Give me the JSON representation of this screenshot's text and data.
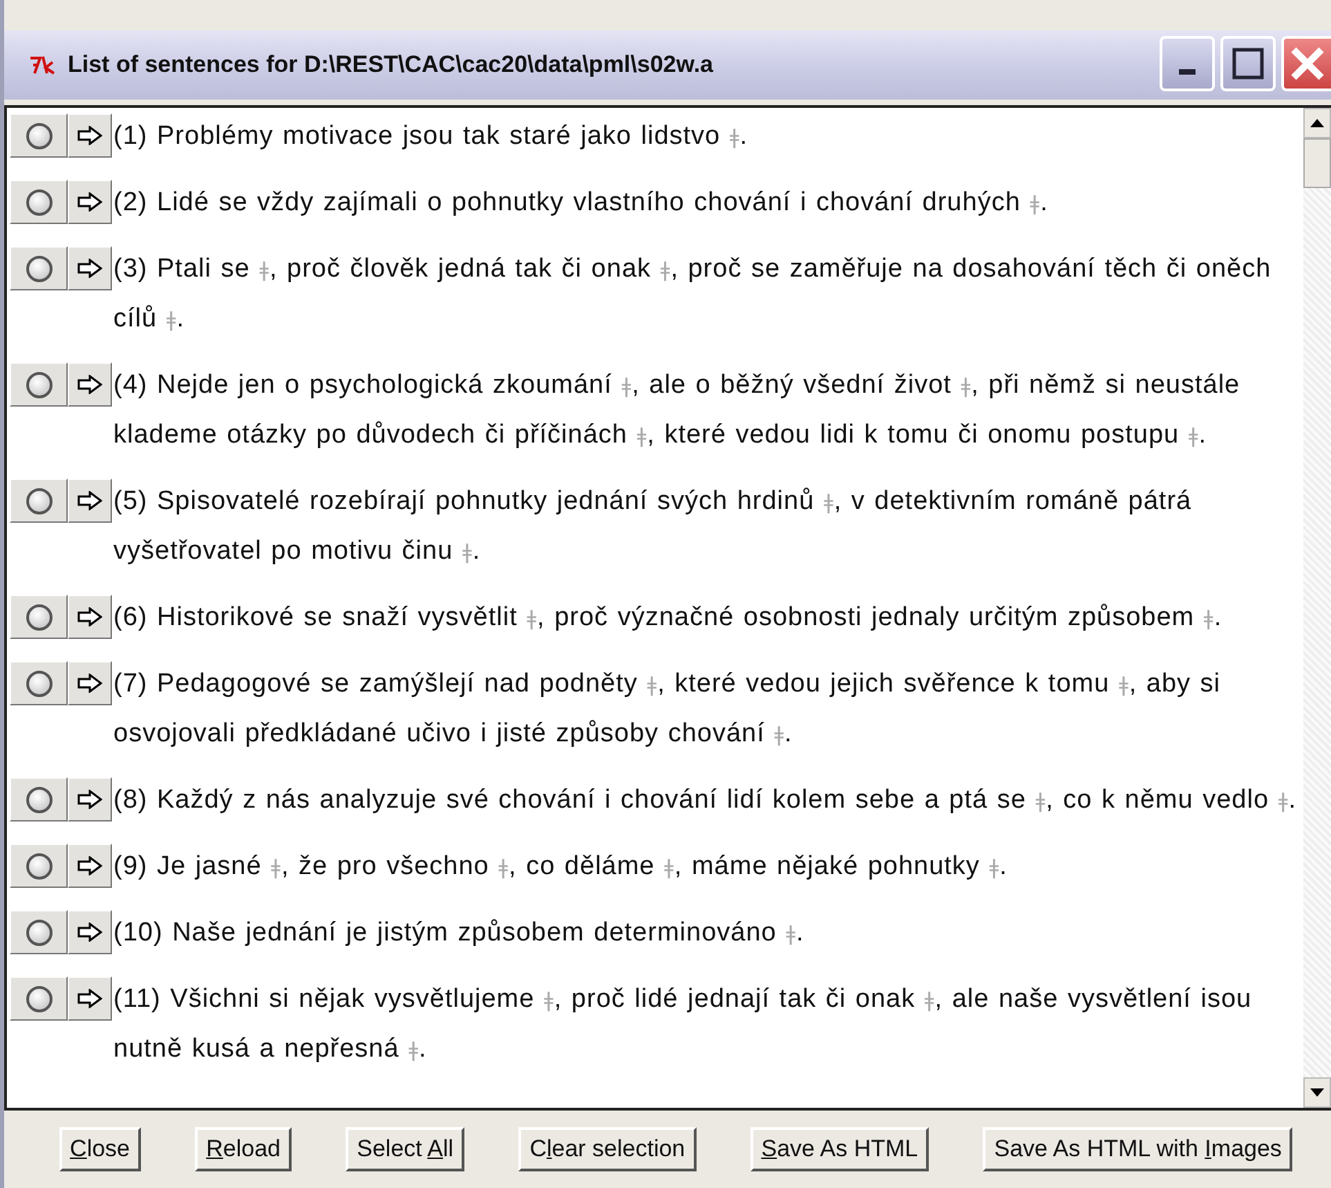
{
  "window": {
    "title": "List of sentences for D:\\REST\\CAC\\cac20\\data\\pml\\s02w.a"
  },
  "sentences": [
    {
      "selected": false,
      "segments": [
        {
          "kind": "text",
          "text": "(1) Problémy motivace jsou tak staré jako lidstvo "
        },
        {
          "kind": "token",
          "text": "ǂ"
        },
        {
          "kind": "text",
          "text": "."
        }
      ]
    },
    {
      "selected": false,
      "segments": [
        {
          "kind": "text",
          "text": "(2) Lidé se vždy zajímali o pohnutky vlastního chování i chování druhých "
        },
        {
          "kind": "token",
          "text": "ǂ"
        },
        {
          "kind": "text",
          "text": "."
        }
      ]
    },
    {
      "selected": false,
      "segments": [
        {
          "kind": "text",
          "text": "(3) Ptali se "
        },
        {
          "kind": "token",
          "text": "ǂ"
        },
        {
          "kind": "text",
          "text": ", proč člověk jedná tak či onak "
        },
        {
          "kind": "token",
          "text": "ǂ"
        },
        {
          "kind": "text",
          "text": ", proč se zaměřuje na dosahování těch či oněch cílů "
        },
        {
          "kind": "token",
          "text": "ǂ"
        },
        {
          "kind": "text",
          "text": "."
        }
      ]
    },
    {
      "selected": false,
      "segments": [
        {
          "kind": "text",
          "text": "(4) Nejde jen o psychologická zkoumání "
        },
        {
          "kind": "token",
          "text": "ǂ"
        },
        {
          "kind": "text",
          "text": ", ale o běžný všední život "
        },
        {
          "kind": "token",
          "text": "ǂ"
        },
        {
          "kind": "text",
          "text": ", při němž si neustále klademe otázky po důvodech či příčinách "
        },
        {
          "kind": "token",
          "text": "ǂ"
        },
        {
          "kind": "text",
          "text": ", které vedou lidi k tomu či onomu postupu "
        },
        {
          "kind": "token",
          "text": "ǂ"
        },
        {
          "kind": "text",
          "text": "."
        }
      ]
    },
    {
      "selected": false,
      "segments": [
        {
          "kind": "text",
          "text": "(5) Spisovatelé rozebírají pohnutky jednání svých hrdinů "
        },
        {
          "kind": "token",
          "text": "ǂ"
        },
        {
          "kind": "text",
          "text": ", v detektivním románě pátrá vyšetřovatel po motivu činu "
        },
        {
          "kind": "token",
          "text": "ǂ"
        },
        {
          "kind": "text",
          "text": "."
        }
      ]
    },
    {
      "selected": false,
      "segments": [
        {
          "kind": "text",
          "text": "(6) Historikové se snaží vysvětlit "
        },
        {
          "kind": "token",
          "text": "ǂ"
        },
        {
          "kind": "text",
          "text": ", proč význačné osobnosti jednaly určitým způsobem "
        },
        {
          "kind": "token",
          "text": "ǂ"
        },
        {
          "kind": "text",
          "text": "."
        }
      ]
    },
    {
      "selected": false,
      "segments": [
        {
          "kind": "text",
          "text": "(7) Pedagogové se zamýšlejí nad podněty "
        },
        {
          "kind": "token",
          "text": "ǂ"
        },
        {
          "kind": "text",
          "text": ", které vedou jejich svěřence k tomu "
        },
        {
          "kind": "token",
          "text": "ǂ"
        },
        {
          "kind": "text",
          "text": ", aby si osvojovali předkládané učivo i jisté způsoby chování "
        },
        {
          "kind": "token",
          "text": "ǂ"
        },
        {
          "kind": "text",
          "text": "."
        }
      ]
    },
    {
      "selected": false,
      "segments": [
        {
          "kind": "text",
          "text": "(8) Každý z nás analyzuje své chování i chování lidí kolem sebe a ptá se "
        },
        {
          "kind": "token",
          "text": "ǂ"
        },
        {
          "kind": "text",
          "text": ", co k němu vedlo "
        },
        {
          "kind": "token",
          "text": "ǂ"
        },
        {
          "kind": "text",
          "text": "."
        }
      ]
    },
    {
      "selected": false,
      "segments": [
        {
          "kind": "text",
          "text": "(9) Je jasné "
        },
        {
          "kind": "token",
          "text": "ǂ"
        },
        {
          "kind": "text",
          "text": ", že pro všechno "
        },
        {
          "kind": "token",
          "text": "ǂ"
        },
        {
          "kind": "text",
          "text": ", co děláme "
        },
        {
          "kind": "token",
          "text": "ǂ"
        },
        {
          "kind": "text",
          "text": ", máme nějaké pohnutky "
        },
        {
          "kind": "token",
          "text": "ǂ"
        },
        {
          "kind": "text",
          "text": "."
        }
      ]
    },
    {
      "selected": false,
      "segments": [
        {
          "kind": "text",
          "text": "(10) Naše jednání je jistým způsobem determinováno "
        },
        {
          "kind": "token",
          "text": "ǂ"
        },
        {
          "kind": "text",
          "text": "."
        }
      ]
    },
    {
      "selected": false,
      "segments": [
        {
          "kind": "text",
          "text": "(11) Všichni si nějak vysvětlujeme "
        },
        {
          "kind": "token",
          "text": "ǂ"
        },
        {
          "kind": "text",
          "text": ", proč lidé jednají tak či onak "
        },
        {
          "kind": "token",
          "text": "ǂ"
        },
        {
          "kind": "text",
          "text": ", ale naše vysvětlení isou nutně kusá a nepřesná "
        },
        {
          "kind": "token",
          "text": "ǂ"
        },
        {
          "kind": "text",
          "text": "."
        }
      ]
    }
  ],
  "buttons": [
    {
      "label": "**C**lose"
    },
    {
      "label": "**R**eload"
    },
    {
      "label": "Select **A**ll"
    },
    {
      "label": "C**l**ear selection"
    },
    {
      "label": "**S**ave As HTML"
    },
    {
      "label": "Save As HTML with **I**mages"
    }
  ]
}
